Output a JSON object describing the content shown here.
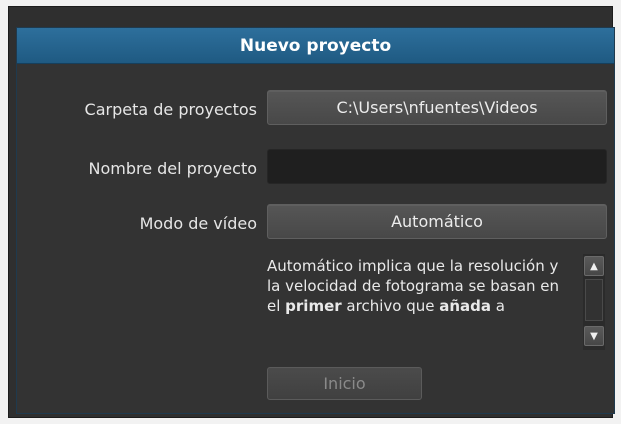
{
  "dialog": {
    "title": "Nuevo proyecto"
  },
  "fields": {
    "project_folder_label": "Carpeta de proyectos",
    "project_folder_value": "C:\\Users\\nfuentes\\Videos",
    "project_name_label": "Nombre del proyecto",
    "project_name_value": "",
    "video_mode_label": "Modo de vídeo",
    "video_mode_value": "Automático"
  },
  "description": {
    "part1": "Automático implica que la resolución y la velocidad de fotograma se basan en el ",
    "bold1": "primer",
    "part2": " archivo que ",
    "bold2": "añada",
    "part3": " a"
  },
  "scroll": {
    "up_icon": "▲",
    "down_icon": "▼"
  },
  "actions": {
    "start_label": "Inicio"
  },
  "colors": {
    "title_bar": "#2d6f9c",
    "panel": "#333333",
    "text": "#e6e6e6"
  }
}
